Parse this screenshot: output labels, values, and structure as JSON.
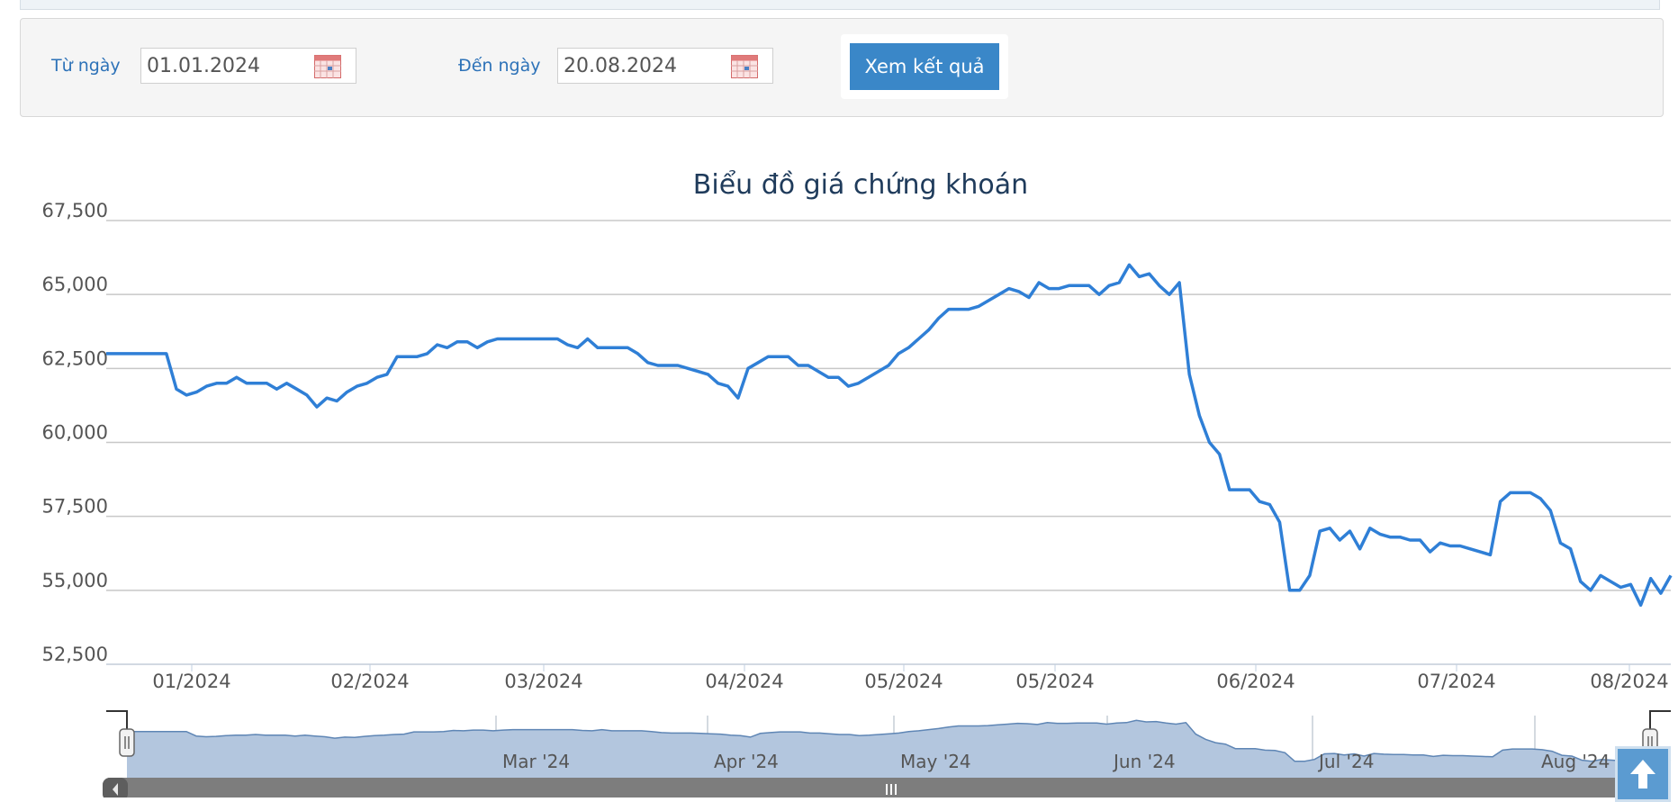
{
  "filter": {
    "from_label": "Từ ngày",
    "from_value": "01.01.2024",
    "to_label": "Đến ngày",
    "to_value": "20.08.2024",
    "submit_label": "Xem kết quả"
  },
  "colors": {
    "line": "#2f7fd6",
    "navigator_fill": "#b3c6de",
    "navigator_line": "#5f86b5",
    "button": "#3a87c8",
    "grid": "#c8c8c8",
    "scrollbar": "#7d7d7d"
  },
  "chart_data": {
    "type": "line",
    "title": "Biểu đồ giá chứng khoán",
    "ylim": [
      52500,
      67500
    ],
    "yticks": [
      52500,
      55000,
      57500,
      60000,
      62500,
      65000,
      67500
    ],
    "ytick_labels": [
      "52,500",
      "55,000",
      "57,500",
      "60,000",
      "62,500",
      "65,000",
      "67,500"
    ],
    "x_labels": [
      "01/2024",
      "02/2024",
      "03/2024",
      "04/2024",
      "05/2024",
      "05/2024",
      "06/2024",
      "07/2024",
      "08/2024"
    ],
    "navigator_labels": [
      "Mar '24",
      "Apr '24",
      "May '24",
      "Jun '24",
      "Jul '24",
      "Aug '24"
    ],
    "grid": true,
    "series": [
      {
        "values": [
          63000,
          63000,
          63000,
          63000,
          63000,
          63000,
          63000,
          61800,
          61600,
          61700,
          61900,
          62000,
          62000,
          62200,
          62000,
          62000,
          62000,
          61800,
          62000,
          61800,
          61600,
          61200,
          61500,
          61400,
          61700,
          61900,
          62000,
          62200,
          62300,
          62900,
          62900,
          62900,
          63000,
          63300,
          63200,
          63400,
          63400,
          63200,
          63400,
          63500,
          63500,
          63500,
          63500,
          63500,
          63500,
          63500,
          63300,
          63200,
          63500,
          63200,
          63200,
          63200,
          63200,
          63000,
          62700,
          62600,
          62600,
          62600,
          62500,
          62400,
          62300,
          62000,
          61900,
          61500,
          62500,
          62700,
          62900,
          62900,
          62900,
          62600,
          62600,
          62400,
          62200,
          62200,
          61900,
          62000,
          62200,
          62400,
          62600,
          63000,
          63200,
          63500,
          63800,
          64200,
          64500,
          64500,
          64500,
          64600,
          64800,
          65000,
          65200,
          65100,
          64900,
          65400,
          65200,
          65200,
          65300,
          65300,
          65300,
          65000,
          65300,
          65400,
          66000,
          65600,
          65700,
          65300,
          65000,
          65400,
          62300,
          60900,
          60000,
          59600,
          58400,
          58400,
          58400,
          58000,
          57900,
          57300,
          55000,
          55000,
          55500,
          57000,
          57100,
          56700,
          57000,
          56400,
          57100,
          56900,
          56800,
          56800,
          56700,
          56700,
          56300,
          56600,
          56500,
          56500,
          56400,
          56300,
          56200,
          58000,
          58300,
          58300,
          58300,
          58100,
          57700,
          56600,
          56400,
          55300,
          55000,
          55500,
          55300,
          55100,
          55200,
          54500,
          55400,
          54900,
          55500
        ]
      }
    ]
  }
}
